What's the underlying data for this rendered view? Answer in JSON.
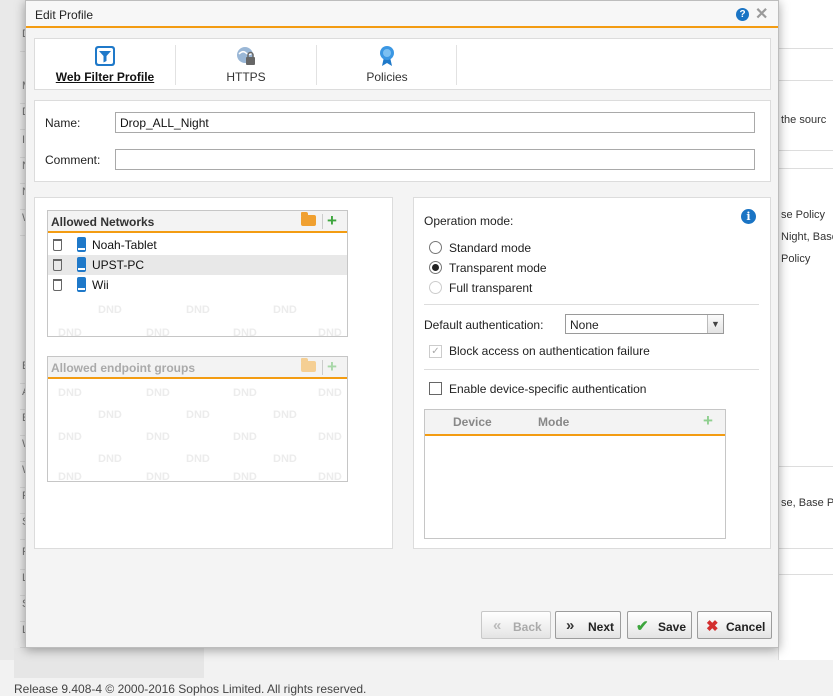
{
  "background": {
    "left_letters": [
      "D",
      "M",
      "D",
      "I",
      "N",
      "N",
      "W",
      "",
      "",
      "A",
      "",
      "E",
      "A",
      "E",
      "W",
      "W",
      "F",
      "S",
      "F",
      "L",
      "S",
      "L"
    ],
    "right_texts": [
      "the sourc",
      "se Policy",
      "Night, Base,",
      "Policy",
      "se, Base Po"
    ]
  },
  "footer": "Release 9.408-4  © 2000-2016 Sophos Limited. All rights reserved.",
  "dialog": {
    "title": "Edit Profile",
    "help_icon": "?",
    "close_icon": "✕"
  },
  "tabs": [
    {
      "label": "Web Filter Profile",
      "icon": "filter-icon",
      "active": true
    },
    {
      "label": "HTTPS",
      "icon": "globe-lock-icon",
      "active": false
    },
    {
      "label": "Policies",
      "icon": "ribbon-icon",
      "active": false
    }
  ],
  "form": {
    "name_label": "Name:",
    "name_value": "Drop_ALL_Night",
    "comment_label": "Comment:",
    "comment_value": ""
  },
  "allowed_networks": {
    "title": "Allowed Networks",
    "items": [
      "Noah-Tablet",
      "UPST-PC",
      "Wii"
    ],
    "watermark": "DND"
  },
  "allowed_endpoint_groups": {
    "title": "Allowed endpoint groups",
    "items": [],
    "watermark": "DND"
  },
  "operation": {
    "label": "Operation mode:",
    "modes": [
      {
        "label": "Standard mode",
        "selected": false,
        "enabled": true
      },
      {
        "label": "Transparent mode",
        "selected": true,
        "enabled": true
      },
      {
        "label": "Full transparent",
        "selected": false,
        "enabled": false
      }
    ],
    "default_auth_label": "Default authentication:",
    "default_auth_value": "None",
    "block_access_label": "Block access on authentication failure",
    "block_access_checked": true,
    "device_auth_label": "Enable device-specific authentication",
    "device_auth_checked": false,
    "device_table": {
      "columns": [
        "Device",
        "Mode"
      ]
    }
  },
  "buttons": {
    "back": "Back",
    "next": "Next",
    "save": "Save",
    "cancel": "Cancel"
  },
  "colors": {
    "accent": "#f39c12",
    "info_blue": "#1a74c4",
    "add_green": "#3da53d",
    "cancel_red": "#d32f2f"
  }
}
